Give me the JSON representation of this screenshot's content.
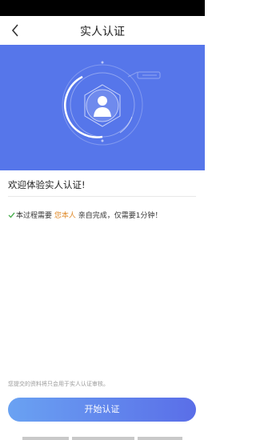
{
  "header": {
    "title": "实人认证"
  },
  "icons": {
    "back": "back-arrow-icon",
    "hero": "face-scan-icon",
    "check": "check-icon"
  },
  "welcome": {
    "text": "欢迎体验实人认证!"
  },
  "process": {
    "prefix": "本过程需要",
    "highlight": "您本人",
    "suffix": "亲自完成，仅需要1分钟！"
  },
  "footer": {
    "notice": "您提交的资料将只会用于实人认证审核。",
    "start_button": "开始认证"
  },
  "colors": {
    "hero_bg": "#5676ea",
    "highlight": "#e08a2a",
    "check": "#4caf50",
    "button_gradient_start": "#6aa2f2",
    "button_gradient_end": "#5a6ee8"
  }
}
